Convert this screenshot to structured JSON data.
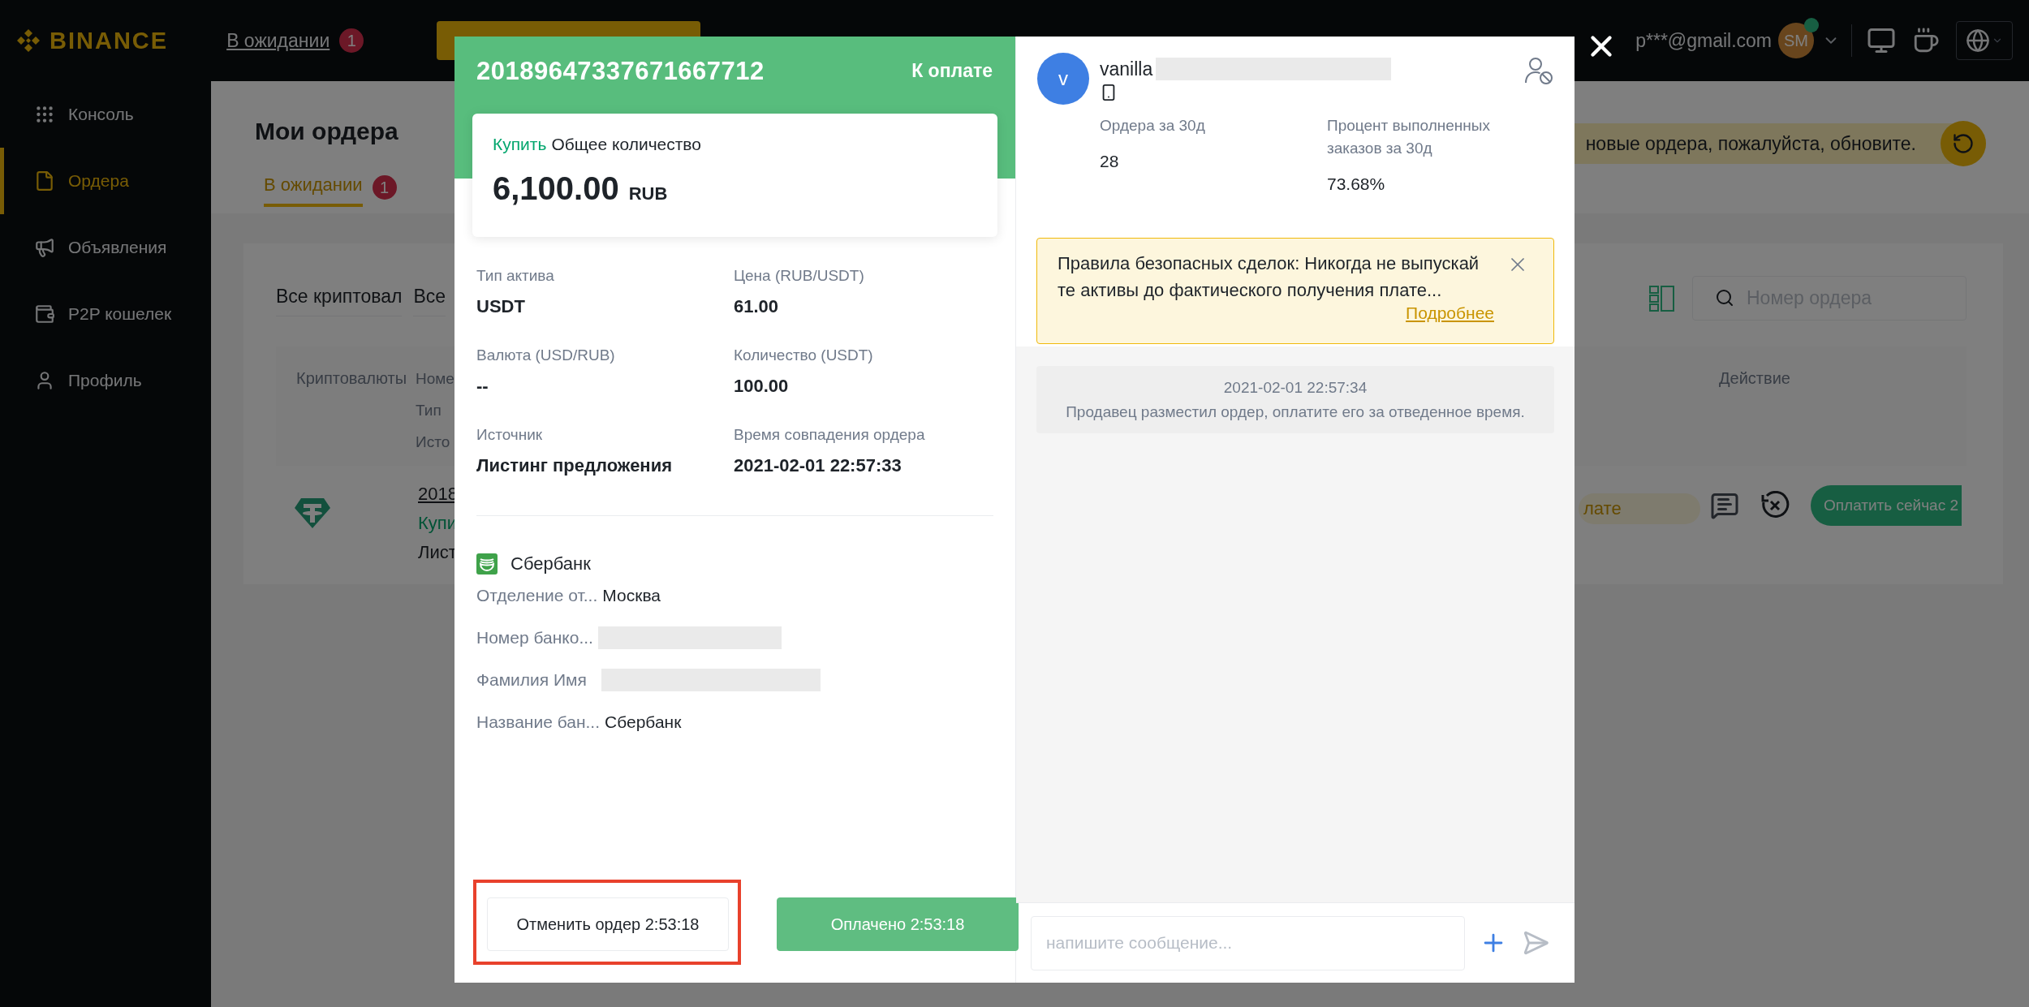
{
  "header": {
    "logo": "BINANCE",
    "pending_link": "В ожидании",
    "pending_count": "1",
    "email": "p***@gmail.com",
    "avatar_initials": "SM"
  },
  "sidebar": {
    "items": [
      {
        "label": "Консоль",
        "selected": false
      },
      {
        "label": "Ордера",
        "selected": true
      },
      {
        "label": "Объявления",
        "selected": false
      },
      {
        "label": "P2P кошелек",
        "selected": false
      },
      {
        "label": "Профиль",
        "selected": false
      }
    ]
  },
  "page": {
    "title": "Мои ордера",
    "tabs": [
      {
        "label": "В ожидании",
        "count": "1",
        "selected": true
      }
    ],
    "refresh_banner": "новые ордера, пожалуйста, обновите.",
    "filters": [
      "Все криптовал",
      "Все"
    ],
    "search_placeholder": "Номер ордера",
    "table": {
      "columns": [
        "Криптовалюты",
        [
          "Номе",
          "Тип",
          "Исто"
        ],
        "Действие"
      ],
      "rows": [
        {
          "order": "2018",
          "side": "Купи",
          "source": "Лист",
          "status": "лате",
          "pay_button": "Оплатить сейчас 2"
        }
      ]
    }
  },
  "order_modal": {
    "order_number": "20189647337671667712",
    "status": "К оплате",
    "amount_side": "Купить",
    "amount_label": "Общее количество",
    "amount": "6,100.00",
    "currency": "RUB",
    "details": [
      {
        "label": "Тип актива",
        "value": "USDT"
      },
      {
        "label": "Цена (RUB/USDT)",
        "value": "61.00"
      },
      {
        "label": "Валюта (USD/RUB)",
        "value": "--"
      },
      {
        "label": "Количество (USDT)",
        "value": "100.00"
      },
      {
        "label": "Источник",
        "value": "Листинг предложения"
      },
      {
        "label": "Время совпадения ордера",
        "value": "2021-02-01 22:57:33"
      }
    ],
    "payment": {
      "bank": "Сбербанк",
      "rows": [
        {
          "kind": "text",
          "label": "Отделение от...",
          "value": "Москва"
        },
        {
          "kind": "redacted",
          "label": "Номер банко..."
        },
        {
          "kind": "redacted",
          "label": "Фамилия Имя"
        },
        {
          "kind": "text",
          "label": "Название бан...",
          "value": "Сбербанк"
        }
      ]
    },
    "buttons": [
      {
        "kind": "secondary",
        "label": "Отменить ордер 2:53:18",
        "highlighted": true
      },
      {
        "kind": "primary",
        "label": "Оплачено 2:53:18",
        "highlighted": false
      }
    ],
    "counterparty": {
      "avatar_letter": "v",
      "name": "vanilla",
      "name_redacted": true,
      "stats": [
        {
          "label": "Ордера за 30д",
          "value": "28"
        },
        {
          "label": "Процент выполненных заказов за 30д",
          "value": "73.68%"
        }
      ]
    },
    "notice": {
      "text": "Правила безопасных сделок: Никогда не выпускайте активы до фактического получения плате...",
      "link": "Подробнее"
    },
    "chat": {
      "messages": [
        {
          "time": "2021-02-01 22:57:34",
          "text": "Продавец разместил ордер, оплатите его за отведенное время."
        }
      ],
      "input_placeholder": "напишите сообщение..."
    }
  }
}
